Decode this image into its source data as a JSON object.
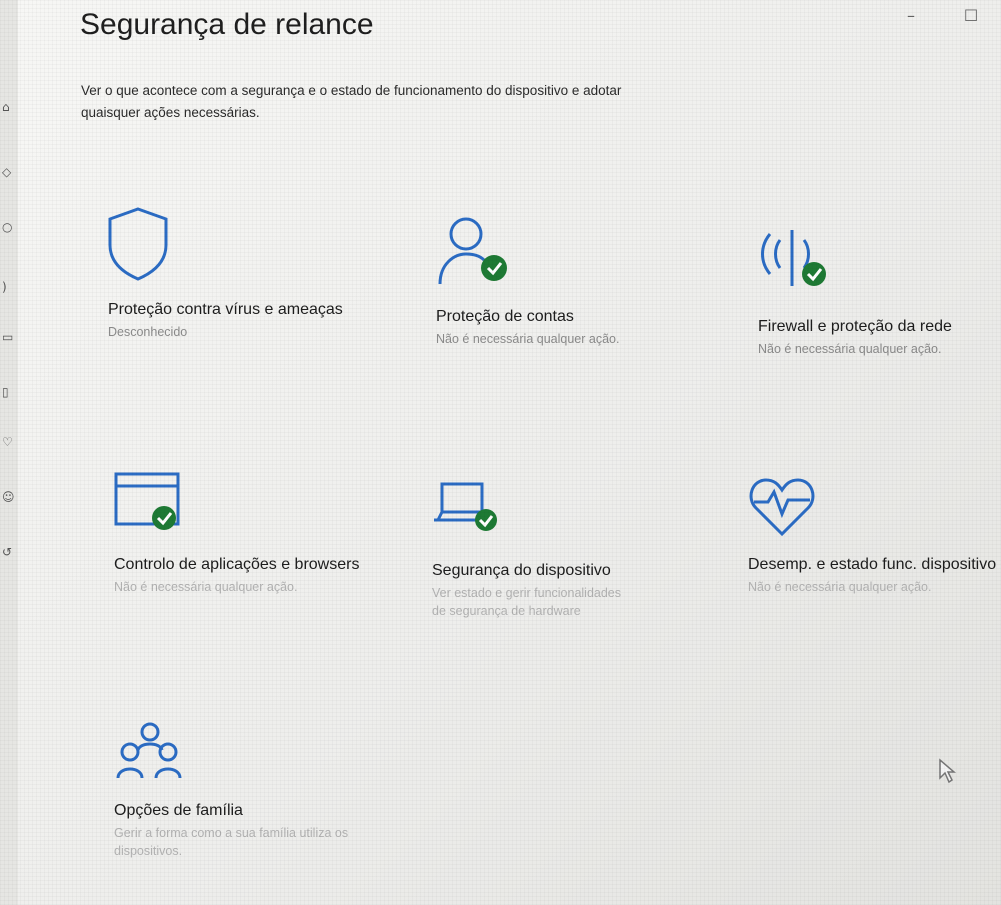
{
  "header": {
    "title": "Segurança de relance",
    "description": "Ver o que acontece com a segurança e o estado de funcionamento do dispositivo e adotar quaisquer ações necessárias."
  },
  "colors": {
    "accent": "#2b6cc4",
    "status_ok": "#1e7a34"
  },
  "tiles": [
    {
      "icon": "shield-icon",
      "title": "Proteção contra vírus e ameaças",
      "subtitle": "Desconhecido"
    },
    {
      "icon": "account-check-icon",
      "title": "Proteção de contas",
      "subtitle": "Não é necessária qualquer ação."
    },
    {
      "icon": "network-check-icon",
      "title": "Firewall e proteção da rede",
      "subtitle": "Não é necessária qualquer ação."
    },
    {
      "icon": "app-browser-check-icon",
      "title": "Controlo de aplicações e browsers",
      "subtitle": "Não é necessária qualquer ação."
    },
    {
      "icon": "laptop-check-icon",
      "title": "Segurança do dispositivo",
      "subtitle": "Ver estado e gerir funcionalidades de segurança de hardware"
    },
    {
      "icon": "heart-pulse-icon",
      "title": "Desemp. e estado func. dispositivo",
      "subtitle": "Não é necessária qualquer ação."
    },
    {
      "icon": "family-icon",
      "title": "Opções de família",
      "subtitle": "Gerir a forma como a sua família utiliza os dispositivos."
    }
  ],
  "window_controls": {
    "minimize": "–",
    "maximize": "☐"
  }
}
